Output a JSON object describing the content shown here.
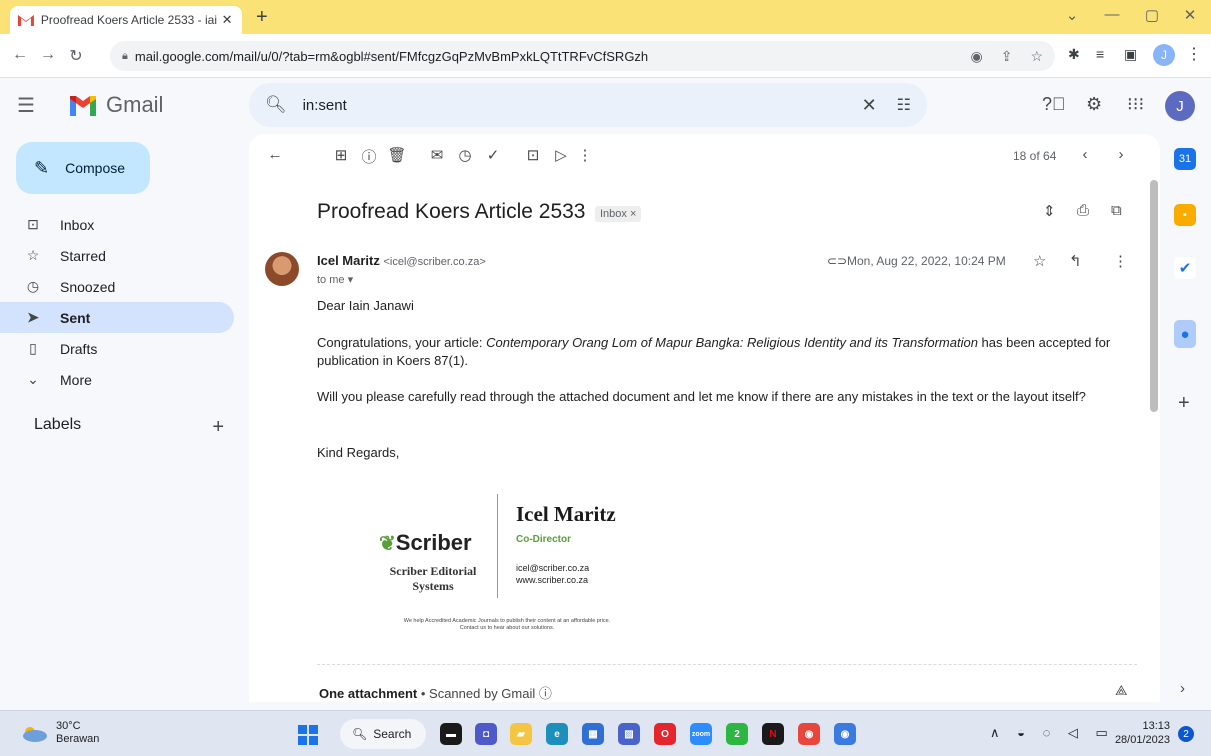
{
  "browser": {
    "tab_title": "Proofread Koers Article 2533 - iai",
    "tab_close": "✕",
    "new_tab": "+",
    "url": "mail.google.com/mail/u/0/?tab=rm&ogbl#sent/FMfcgzGqPzMvBmPxkLQTtTRFvCfSRGzh",
    "profile_initial": "J",
    "window_controls": [
      "⌄",
      "—",
      "▢",
      "✕"
    ]
  },
  "gmail": {
    "logo_text": "Gmail",
    "search_value": "in:sent",
    "avatar_initial": "J",
    "compose_label": "Compose",
    "nav": [
      {
        "label": "Inbox",
        "icon": "inbox-icon",
        "glyph": "⊡"
      },
      {
        "label": "Starred",
        "icon": "star-icon",
        "glyph": "☆"
      },
      {
        "label": "Snoozed",
        "icon": "clock-icon",
        "glyph": "◷"
      },
      {
        "label": "Sent",
        "icon": "send-icon",
        "glyph": "➤"
      },
      {
        "label": "Drafts",
        "icon": "draft-icon",
        "glyph": "▯"
      },
      {
        "label": "More",
        "icon": "chevron-down-icon",
        "glyph": "⌄"
      }
    ],
    "labels_heading": "Labels",
    "labels_add": "+"
  },
  "message": {
    "pager": "18 of 64",
    "subject": "Proofread Koers Article 2533",
    "label_chip": "Inbox ×",
    "sender_name": "Icel Maritz",
    "sender_email": "<icel@scriber.co.za>",
    "to_line": "to me ▾",
    "date": "Mon, Aug 22, 2022, 10:24 PM",
    "greeting": "Dear Iain Janawi",
    "para1_before": "Congratulations, your article: ",
    "para1_title": "Contemporary Orang Lom of Mapur Bangka: Religious Identity and its Transformation",
    "para1_after": " has been accepted for publication in Koers 87(1).",
    "para2": "Will you please carefully read through the attached document and let me know if there are any mistakes in the text or the layout itself?",
    "closing": "Kind Regards,",
    "attachment_title": "One attachment",
    "attachment_sep": " • ",
    "attachment_scan": "Scanned by Gmail ⓘ"
  },
  "signature": {
    "brand": "Scriber",
    "company_line1": "Scriber Editorial",
    "company_line2": "Systems",
    "name": "Icel Maritz",
    "role": "Co-Director",
    "email": "icel@scriber.co.za",
    "website": "www.scriber.co.za",
    "tagline1": "We help Accredited Academic Journals to publish their content at an affordable price.",
    "tagline2": "Contact us to hear about our solutions."
  },
  "taskbar": {
    "temperature": "30°C",
    "weather": "Berawan",
    "search_label": "Search",
    "time": "13:13",
    "date": "28/01/2023",
    "notification_count": "2",
    "apps": [
      {
        "name": "file-explorer",
        "color": "#f2b01e",
        "glyph": "▬"
      },
      {
        "name": "meet",
        "color": "#5059c9",
        "glyph": "◘"
      },
      {
        "name": "folder",
        "color": "#f4c542",
        "glyph": "▰"
      },
      {
        "name": "edge",
        "color": "#1c8fbd",
        "glyph": "e"
      },
      {
        "name": "store",
        "color": "#2f6fd6",
        "glyph": "▦"
      },
      {
        "name": "photos",
        "color": "#4a63c9",
        "glyph": "▨"
      },
      {
        "name": "opera",
        "color": "#e3262e",
        "glyph": "O"
      },
      {
        "name": "zoom",
        "color": "#2d8cff",
        "glyph": "zoom"
      },
      {
        "name": "whatsapp",
        "color": "#2bb741",
        "glyph": "2"
      },
      {
        "name": "netflix",
        "color": "#1a1a1a",
        "glyph": "N"
      },
      {
        "name": "chrome",
        "color": "#e8453c",
        "glyph": "◉"
      },
      {
        "name": "chrome-profile",
        "color": "#3b7be0",
        "glyph": "◉"
      }
    ],
    "tray": "∧ ◒ ◌ ◁ ▭"
  }
}
